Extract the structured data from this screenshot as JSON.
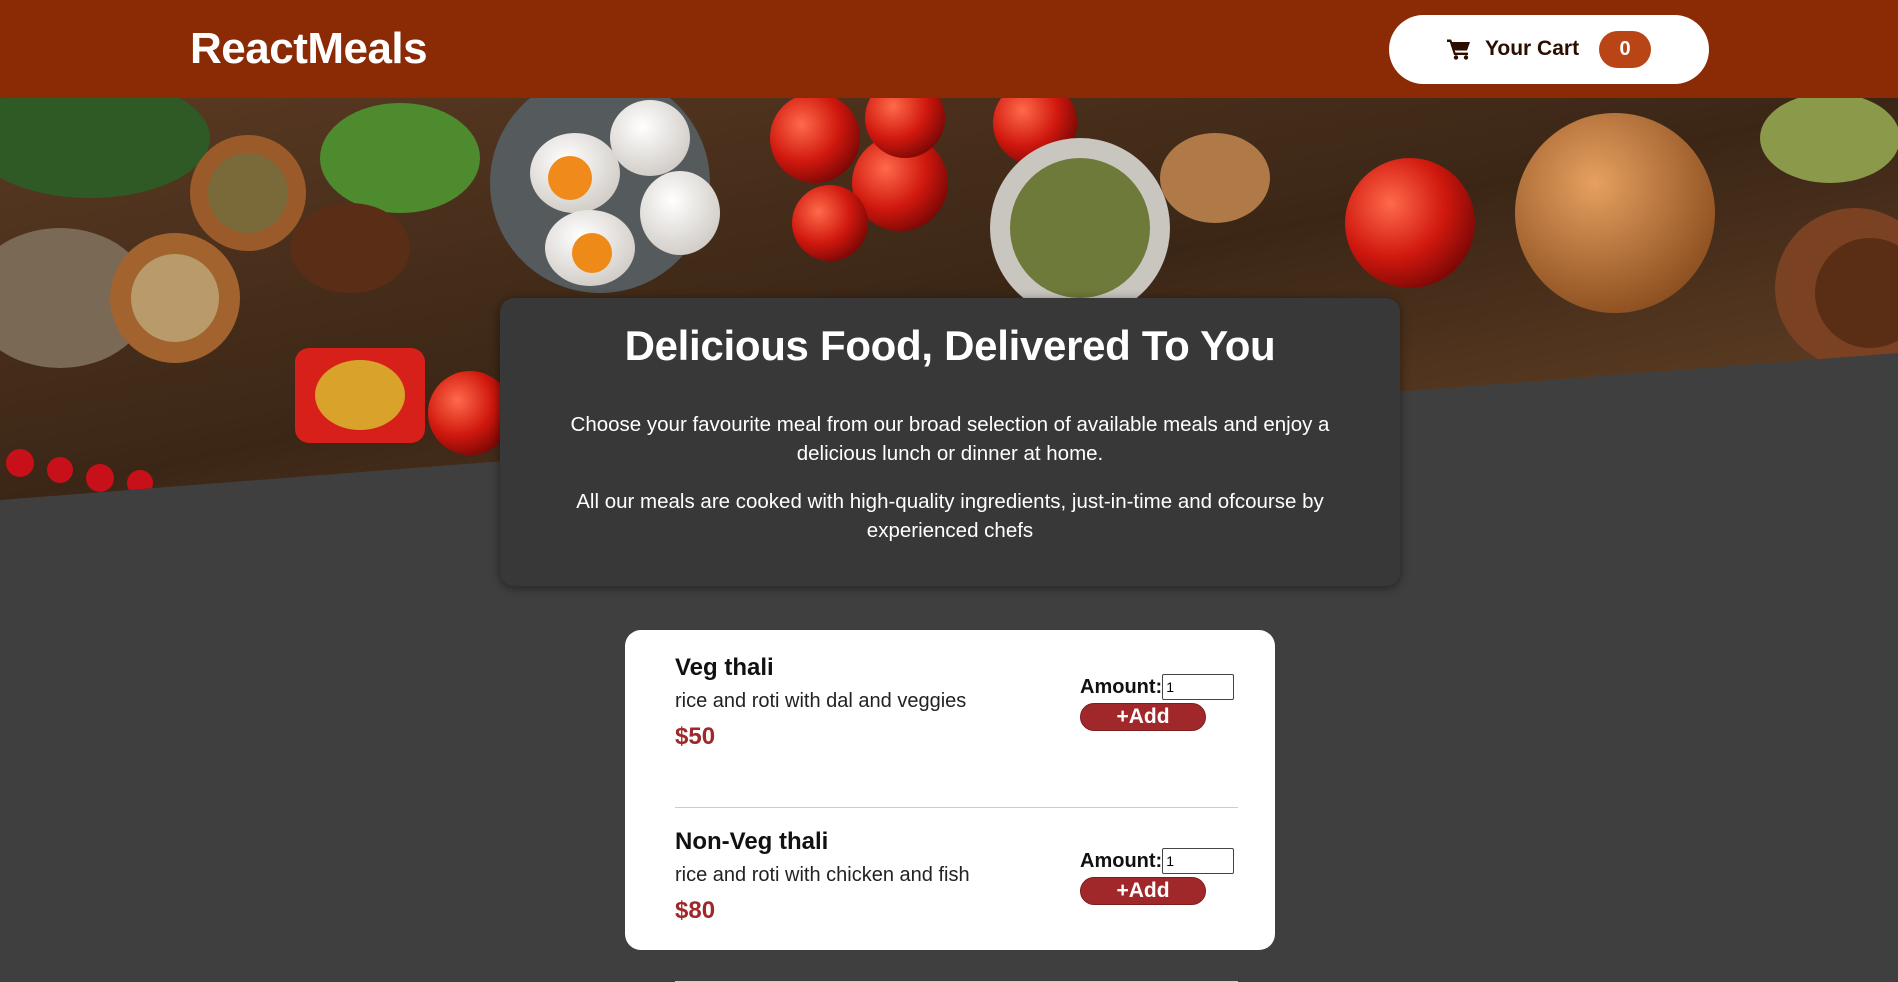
{
  "header": {
    "title": "ReactMeals",
    "cart_label": "Your Cart",
    "cart_count": "0"
  },
  "summary": {
    "heading": "Delicious Food, Delivered To You",
    "paragraph1": "Choose your favourite meal from our broad selection of available meals and enjoy a delicious lunch or dinner at home.",
    "paragraph2": "All our meals are cooked with high-quality ingredients, just-in-time and ofcourse by experienced chefs"
  },
  "meals": [
    {
      "name": "Veg thali",
      "description": "rice and roti with dal and veggies",
      "price": "$50",
      "amount_label": "Amount:",
      "amount_value": "1",
      "add_label": "+Add"
    },
    {
      "name": "Non-Veg thali",
      "description": "rice and roti with chicken and fish",
      "price": "$80",
      "amount_label": "Amount:",
      "amount_value": "1",
      "add_label": "+Add"
    }
  ],
  "colors": {
    "header_bg": "#8a2b06",
    "page_bg": "#3f3f3f",
    "summary_bg": "#383838",
    "badge_bg": "#b94517",
    "accent": "#a0282a"
  },
  "icons": {
    "cart": "cart-icon",
    "hero": "food-banner-image"
  }
}
